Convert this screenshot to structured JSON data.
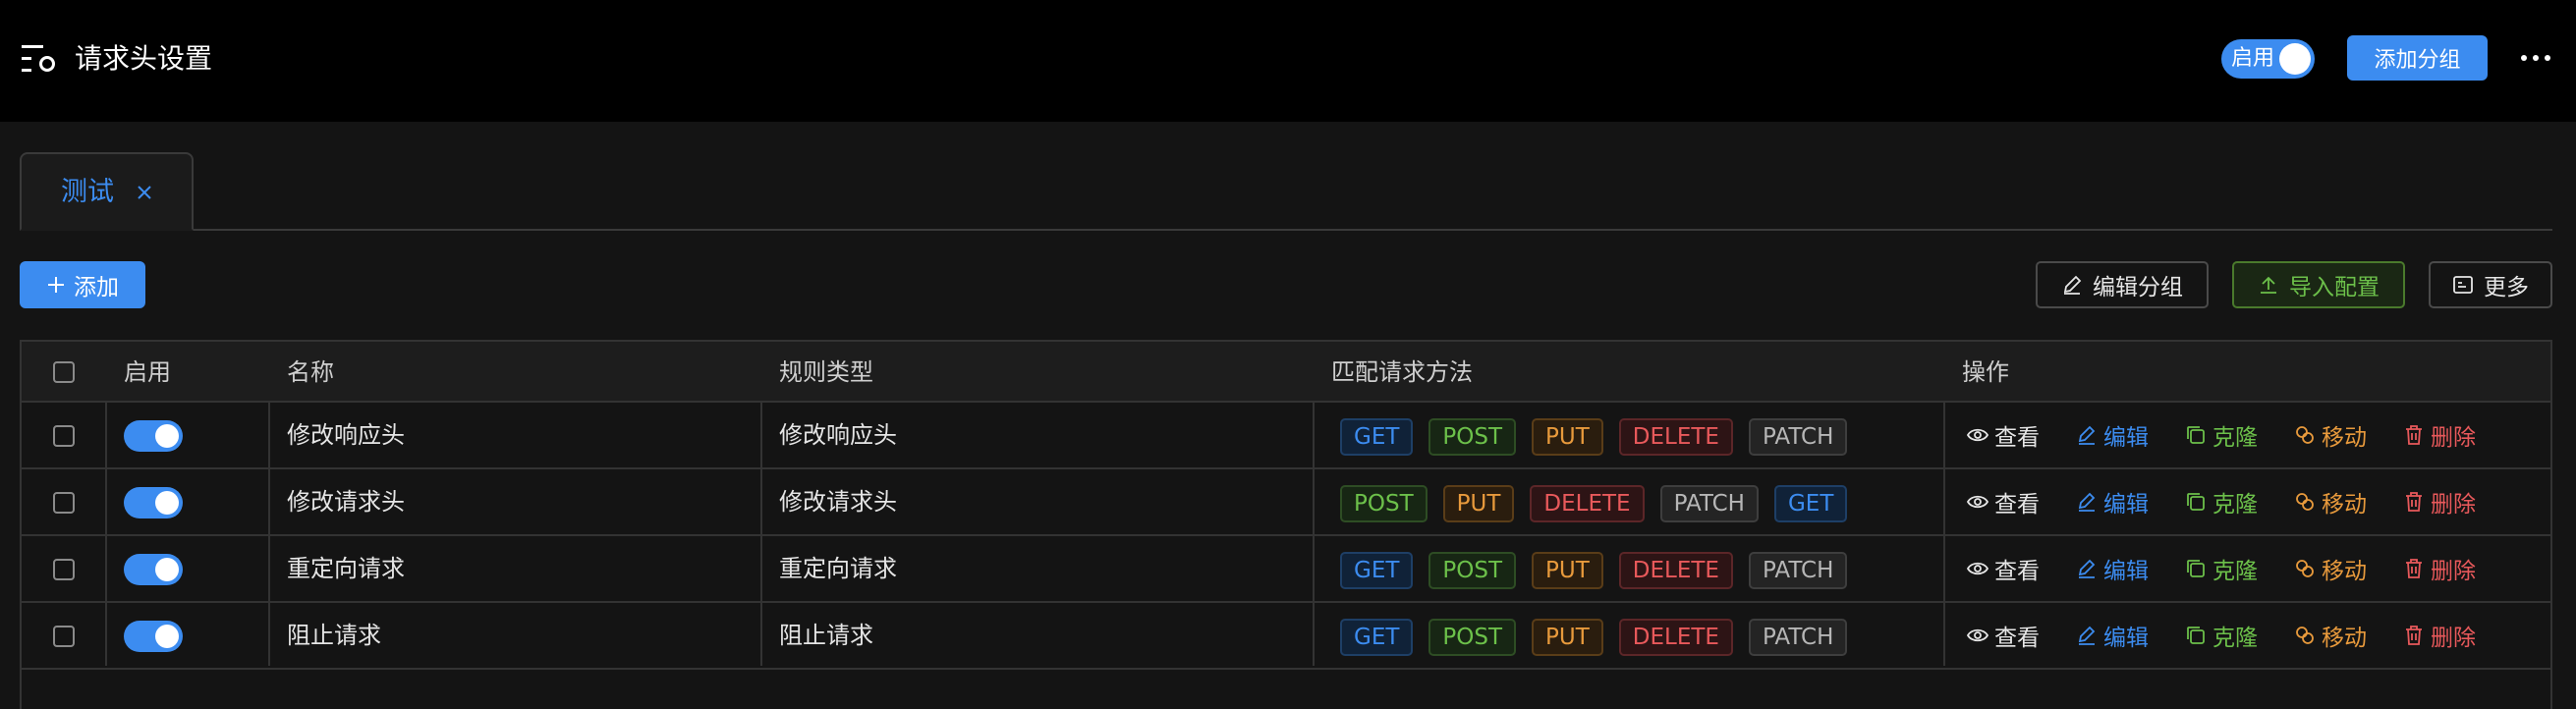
{
  "header": {
    "title": "请求头设置",
    "enable_label": "启用",
    "enable_on": true,
    "add_group_label": "添加分组"
  },
  "tabs": [
    {
      "label": "测试",
      "active": true
    }
  ],
  "toolbar": {
    "add_label": "添加",
    "edit_group_label": "编辑分组",
    "import_label": "导入配置",
    "more_label": "更多"
  },
  "table": {
    "columns": [
      "启用",
      "名称",
      "规则类型",
      "匹配请求方法",
      "操作"
    ],
    "rows": [
      {
        "enabled": true,
        "name": "修改响应头",
        "type": "修改响应头",
        "methods": [
          "GET",
          "POST",
          "PUT",
          "DELETE",
          "PATCH"
        ]
      },
      {
        "enabled": true,
        "name": "修改请求头",
        "type": "修改请求头",
        "methods": [
          "POST",
          "PUT",
          "DELETE",
          "PATCH",
          "GET"
        ]
      },
      {
        "enabled": true,
        "name": "重定向请求",
        "type": "重定向请求",
        "methods": [
          "GET",
          "POST",
          "PUT",
          "DELETE",
          "PATCH"
        ]
      },
      {
        "enabled": true,
        "name": "阻止请求",
        "type": "阻止请求",
        "methods": [
          "GET",
          "POST",
          "PUT",
          "DELETE",
          "PATCH"
        ]
      }
    ],
    "actions": {
      "view": "查看",
      "edit": "编辑",
      "clone": "克隆",
      "move": "移动",
      "delete": "删除"
    }
  },
  "colors": {
    "accent": "#3c8cf0",
    "green": "#6cc04a",
    "orange": "#e89a3c",
    "red": "#e8595b"
  }
}
